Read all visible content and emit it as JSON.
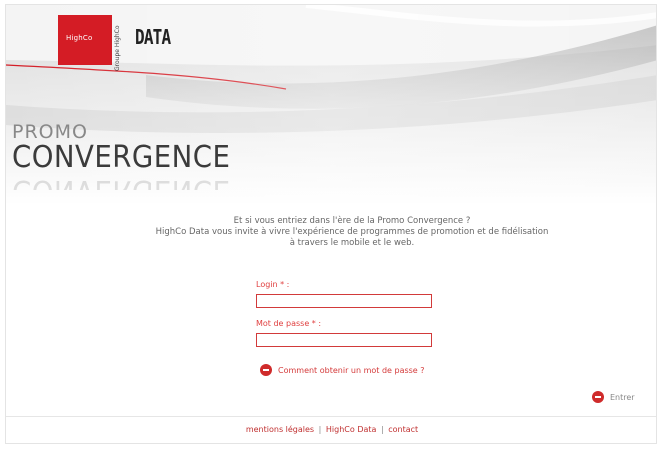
{
  "brand": {
    "logo_text": "HighCo",
    "vertical_text": "Groupe HighCo",
    "data_word": "DATA",
    "accent_color": "#d41c25"
  },
  "hero": {
    "promo": "PROMO",
    "convergence": "CONVERGENCE"
  },
  "intro": {
    "line1": "Et si vous entriez dans l'ère de la Promo Convergence ?",
    "line2": "HighCo Data vous invite à vivre l'expérience de programmes de promotion et de fidélisation",
    "line3": "à travers le mobile et le web."
  },
  "form": {
    "login_label": "Login * :",
    "login_value": "",
    "password_label": "Mot de passe * :",
    "password_value": ""
  },
  "links": {
    "help": "Comment obtenir un mot de passe ?",
    "help_icon": "red-circle-icon",
    "enter": "Entrer",
    "enter_icon": "red-circle-icon"
  },
  "footer": {
    "legal": "mentions légales",
    "highco": "HighCo Data",
    "contact": "contact",
    "separator": "|"
  }
}
